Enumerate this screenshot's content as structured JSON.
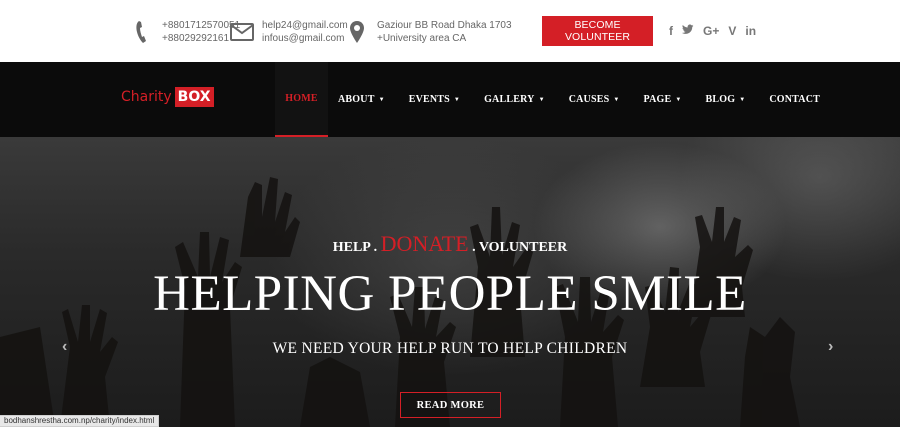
{
  "topbar": {
    "phone": {
      "icon": "phone-icon",
      "line1": "+8801712570051",
      "line2": "+88029292161"
    },
    "email": {
      "icon": "envelope-icon",
      "line1": "help24@gmail.com",
      "line2": "infous@gmail.com"
    },
    "address": {
      "icon": "map-pin-icon",
      "line1": "Gaziour BB Road Dhaka 1703",
      "line2": "+University area CA"
    },
    "volunteer_button": "BECOME VOLUNTEER",
    "social": [
      {
        "icon": "facebook-icon",
        "glyph": "f"
      },
      {
        "icon": "twitter-icon",
        "glyph": "🐦"
      },
      {
        "icon": "google-plus-icon",
        "glyph": "G+"
      },
      {
        "icon": "vine-icon",
        "glyph": "V"
      },
      {
        "icon": "linkedin-icon",
        "glyph": "in"
      }
    ]
  },
  "nav": {
    "logo_text": "Charity",
    "logo_box": "BOX",
    "items": [
      {
        "label": "HOME",
        "dropdown": false,
        "active": true
      },
      {
        "label": "ABOUT",
        "dropdown": true
      },
      {
        "label": "EVENTS",
        "dropdown": true
      },
      {
        "label": "GALLERY",
        "dropdown": true
      },
      {
        "label": "CAUSES",
        "dropdown": true
      },
      {
        "label": "PAGE",
        "dropdown": true
      },
      {
        "label": "BLOG",
        "dropdown": true
      },
      {
        "label": "CONTACT",
        "dropdown": false
      }
    ]
  },
  "hero": {
    "tag_help": "HELP .",
    "tag_donate": "DONATE",
    "tag_volunteer": ". VOLUNTEER",
    "headline": "HELPING PEOPLE SMILE",
    "subline": "WE NEED YOUR HELP RUN TO HELP CHILDREN",
    "read_more": "READ MORE",
    "prev_arrow": "‹",
    "next_arrow": "›"
  },
  "status_url": "bodhanshrestha.com.np/charity/index.html",
  "colors": {
    "accent": "#d41f26",
    "nav_bg": "#0b0b0b"
  }
}
